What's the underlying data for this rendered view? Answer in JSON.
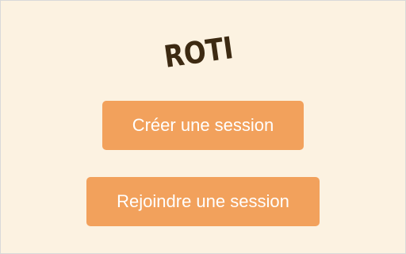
{
  "app": {
    "title": "ROTI"
  },
  "actions": {
    "create_label": "Créer une session",
    "join_label": "Rejoindre une session"
  },
  "colors": {
    "background": "#fcf2e1",
    "button": "#f2a15c",
    "button_text": "#ffffff",
    "title": "#3d2a12"
  }
}
